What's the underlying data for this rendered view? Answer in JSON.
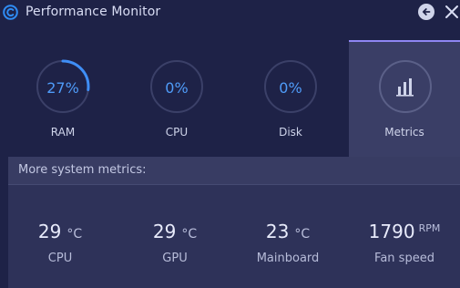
{
  "window": {
    "title": "Performance Monitor",
    "logo_icon": "ccleaner-logo-icon",
    "back_icon": "arrow-left-icon",
    "close_icon": "close-icon",
    "colors": {
      "background": "#1e2247",
      "accent": "#4f9cf9",
      "tab_active": "#3a3e66",
      "tab_indicator": "#8e86f2"
    }
  },
  "gauges": [
    {
      "value": "27%",
      "label": "RAM",
      "percent": 27
    },
    {
      "value": "0%",
      "label": "CPU",
      "percent": 0
    },
    {
      "value": "0%",
      "label": "Disk",
      "percent": 0
    }
  ],
  "metrics_tab": {
    "label": "Metrics",
    "icon": "bar-chart-icon",
    "active": true
  },
  "metrics_panel": {
    "header": "More system metrics:",
    "items": [
      {
        "value": "29",
        "unit": "°C",
        "label": "CPU"
      },
      {
        "value": "29",
        "unit": "°C",
        "label": "GPU"
      },
      {
        "value": "23",
        "unit": "°C",
        "label": "Mainboard"
      },
      {
        "value": "1790",
        "unit": "RPM",
        "label": "Fan speed"
      }
    ]
  }
}
